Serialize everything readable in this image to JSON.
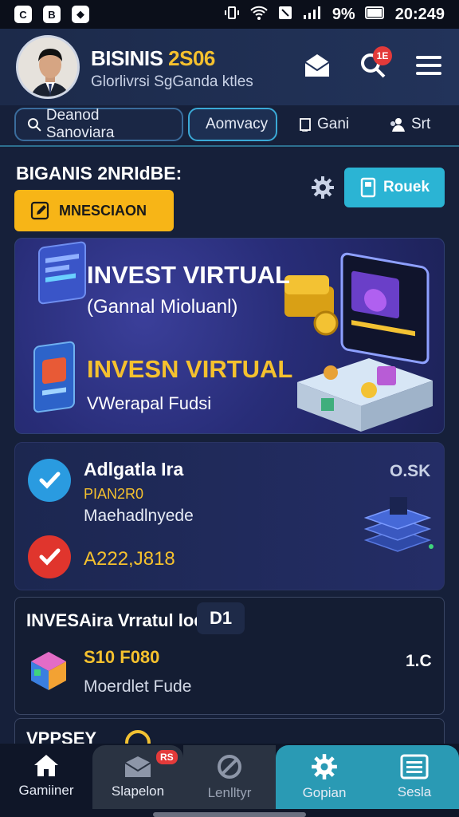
{
  "status_bar": {
    "apps": [
      "C",
      "B",
      "◆"
    ],
    "battery": "9%",
    "time": "20:249"
  },
  "header": {
    "brand_main": "BISINIS",
    "brand_accent": "2S06",
    "tagline": "Glorlivrsi SgGanda ktles",
    "notification_count": "1E"
  },
  "tabs": [
    {
      "label": "Deanod Sanoviara"
    },
    {
      "label": "Aomvacy"
    },
    {
      "label": "Gani"
    },
    {
      "label": "Srt"
    }
  ],
  "section": {
    "title": "BIGANIS 2NRIdBE:",
    "yellow_button": "MNESCIAON",
    "teal_button": "Rouek"
  },
  "banner": {
    "headline_1": "INVEST VIRTUAL",
    "subline_1": "(Gannal Mioluanl)",
    "headline_2": "INVESN VIRTUAL",
    "subline_2": "VWerapal Fudsi"
  },
  "card1": {
    "title": "Adlgatla Ira",
    "code": "PIAN2R0",
    "description": "Maehadlnyede",
    "amount": "A222,J818",
    "tag": "O.SK"
  },
  "card2": {
    "title": "INVESAira Vrratul lode",
    "chip": "D1",
    "price": "S10 F080",
    "subtitle": "Moerdlet Fude",
    "right_value": "1.C"
  },
  "card3": {
    "title": "VPPSEY"
  },
  "bottom_nav": [
    {
      "label": "Gamiiner",
      "icon": "home-icon"
    },
    {
      "label": "Slapelon",
      "icon": "mail-icon",
      "badge": "RS"
    },
    {
      "label": "Lenlltyr",
      "icon": "ban-icon"
    },
    {
      "label": "Gopian",
      "icon": "gear-icon"
    },
    {
      "label": "Sesla",
      "icon": "list-icon"
    }
  ],
  "colors": {
    "accent_yellow": "#f5c12e",
    "accent_teal": "#2bb4d4",
    "badge_red": "#e33a3a"
  }
}
